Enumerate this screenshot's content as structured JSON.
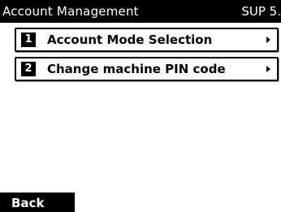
{
  "header": {
    "title": "Account Management",
    "code": "SUP 5."
  },
  "menu": {
    "items": [
      {
        "number": "1",
        "label": "Account Mode Selection",
        "icon": "chevron-right-icon"
      },
      {
        "number": "2",
        "label": "Change machine PIN code",
        "icon": "chevron-right-icon"
      }
    ]
  },
  "footer": {
    "back_label": "Back"
  },
  "colors": {
    "background": "#ffffff",
    "bar": "#000000",
    "bar_text": "#ffffff"
  }
}
